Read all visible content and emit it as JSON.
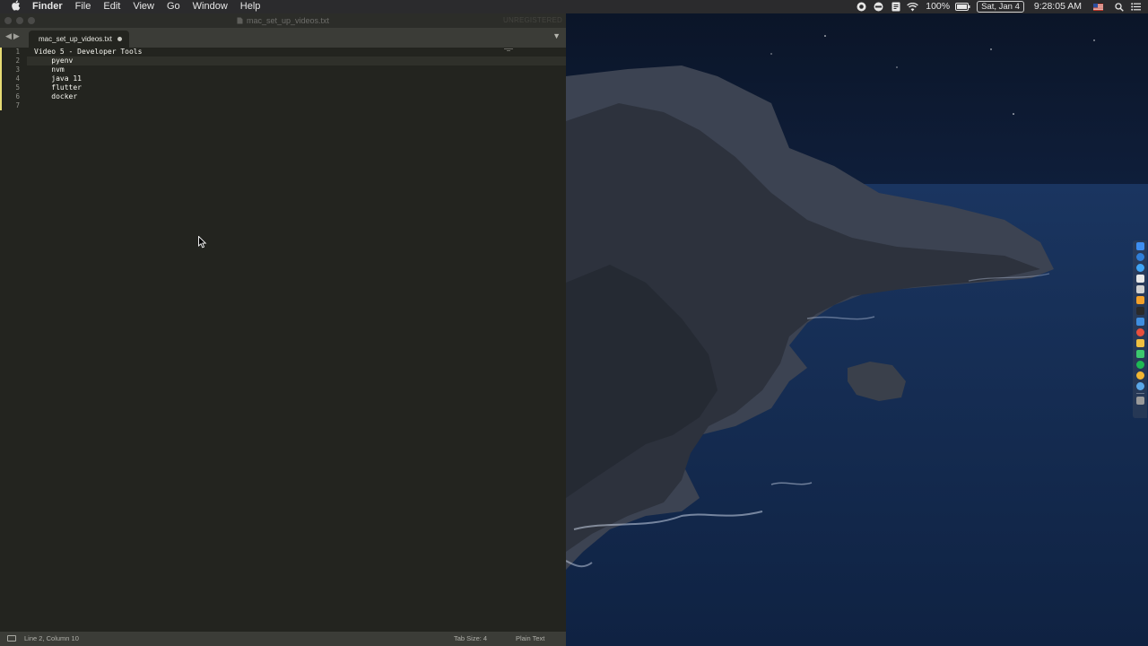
{
  "menubar": {
    "app_name": "Finder",
    "menus": [
      "File",
      "Edit",
      "View",
      "Go",
      "Window",
      "Help"
    ],
    "battery": "100%",
    "date": "Sat, Jan 4",
    "time": "9:28:05 AM",
    "icons": [
      "apple-icon",
      "record-icon",
      "toggle-icon",
      "clipboard-icon",
      "wifi-icon",
      "battery-icon",
      "flag-icon",
      "search-icon",
      "notification-center-icon"
    ]
  },
  "editor": {
    "window_title": "mac_set_up_videos.txt",
    "unregistered_label": "UNREGISTERED",
    "tab_label": "mac_set_up_videos.txt",
    "line_numbers": [
      "1",
      "2",
      "3",
      "4",
      "5",
      "6",
      "7"
    ],
    "lines": [
      "Video 5 - Developer Tools",
      "    pyenv",
      "    nvm",
      "    java 11",
      "    flutter",
      "    docker",
      ""
    ],
    "status": {
      "position": "Line 2, Column 10",
      "tab_size": "Tab Size: 4",
      "syntax": "Plain Text"
    }
  },
  "dock": {
    "apps": [
      "finder-icon",
      "safari-icon",
      "browser-icon",
      "notes-icon",
      "photo-icon",
      "sublime-icon",
      "terminal-icon",
      "maps-icon",
      "navigator-icon",
      "photos-icon",
      "messages-icon",
      "spotify-icon",
      "chrome-icon",
      "network-icon",
      "trash-icon"
    ],
    "colors": [
      "#3d8ef0",
      "#2f7ed8",
      "#3fa4f5",
      "#e8e8e8",
      "#d0d0d0",
      "#f4a12a",
      "#2a2a2a",
      "#3f8ee0",
      "#e84f3d",
      "#f0c040",
      "#3cc86e",
      "#1db954",
      "#f2b632",
      "#5aa7e8",
      "#9a9a9a"
    ]
  }
}
